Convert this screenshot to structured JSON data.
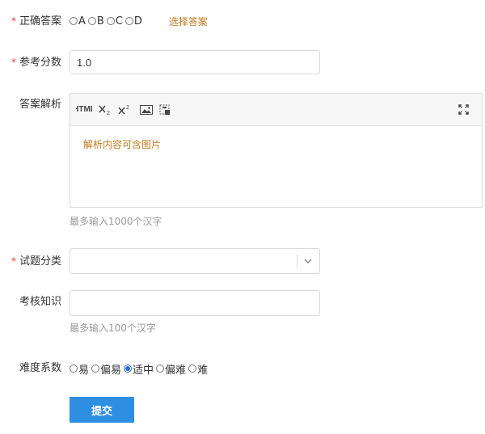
{
  "correct_answer": {
    "label": "正确答案",
    "options": [
      "A",
      "B",
      "C",
      "D"
    ],
    "choose_link": "选择答案"
  },
  "score": {
    "label": "参考分数",
    "value": "1.0"
  },
  "analysis": {
    "label": "答案解析",
    "toolbar": {
      "html_label": "HTML",
      "subscript_icon": "subscript-icon",
      "superscript_icon": "superscript-icon",
      "image_icon": "image-icon",
      "select_icon": "select-area-icon",
      "fullscreen_icon": "fullscreen-icon"
    },
    "placeholder": "解析内容可含图片",
    "hint": "最多输入1000个汉字"
  },
  "category": {
    "label": "试题分类",
    "value": ""
  },
  "knowledge": {
    "label": "考核知识",
    "value": "",
    "hint": "最多输入100个汉字"
  },
  "difficulty": {
    "label": "难度系数",
    "options": [
      "易",
      "偏易",
      "适中",
      "偏难",
      "难"
    ],
    "selected": "适中"
  },
  "submit_label": "提交"
}
